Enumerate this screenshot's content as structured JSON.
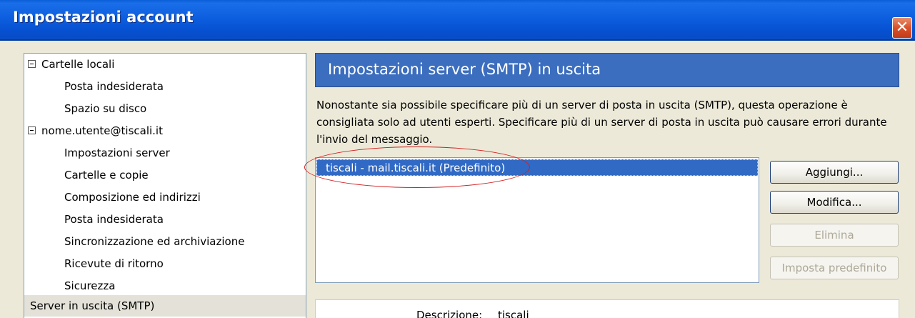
{
  "window": {
    "title": "Impostazioni account",
    "close_glyph": "✕",
    "close_icon": "close-icon"
  },
  "tree": {
    "items": [
      {
        "label": "Cartelle locali",
        "expander": true
      },
      {
        "label": "Posta indesiderata"
      },
      {
        "label": "Spazio su disco"
      },
      {
        "label": "nome.utente@tiscali.it",
        "expander": true
      },
      {
        "label": "Impostazioni server"
      },
      {
        "label": "Cartelle e copie"
      },
      {
        "label": "Composizione ed indirizzi"
      },
      {
        "label": "Posta indesiderata"
      },
      {
        "label": "Sincronizzazione ed archiviazione"
      },
      {
        "label": "Ricevute di ritorno"
      },
      {
        "label": "Sicurezza"
      },
      {
        "label": "Server in uscita (SMTP)",
        "selected": true
      }
    ]
  },
  "panel": {
    "header": "Impostazioni server (SMTP) in uscita",
    "description": "Nonostante sia possibile specificare più di un server di posta in uscita (SMTP), questa operazione è consigliata solo ad utenti esperti. Specificare più di un server di posta in uscita può causare errori durante l'invio del messaggio.",
    "servers": [
      {
        "label": "tiscali - mail.tiscali.it (Predefinito)",
        "selected": true
      }
    ],
    "buttons": {
      "add": "Aggiungi...",
      "edit": "Modifica...",
      "delete": "Elimina",
      "set_default": "Imposta predefinito"
    },
    "details": {
      "description_label": "Descrizione:",
      "description_value": "tiscali"
    }
  },
  "colors": {
    "header_bg": "#3c6ebf",
    "selection_bg": "#316ac5",
    "annotation_ellipse": "#d21e1e"
  }
}
